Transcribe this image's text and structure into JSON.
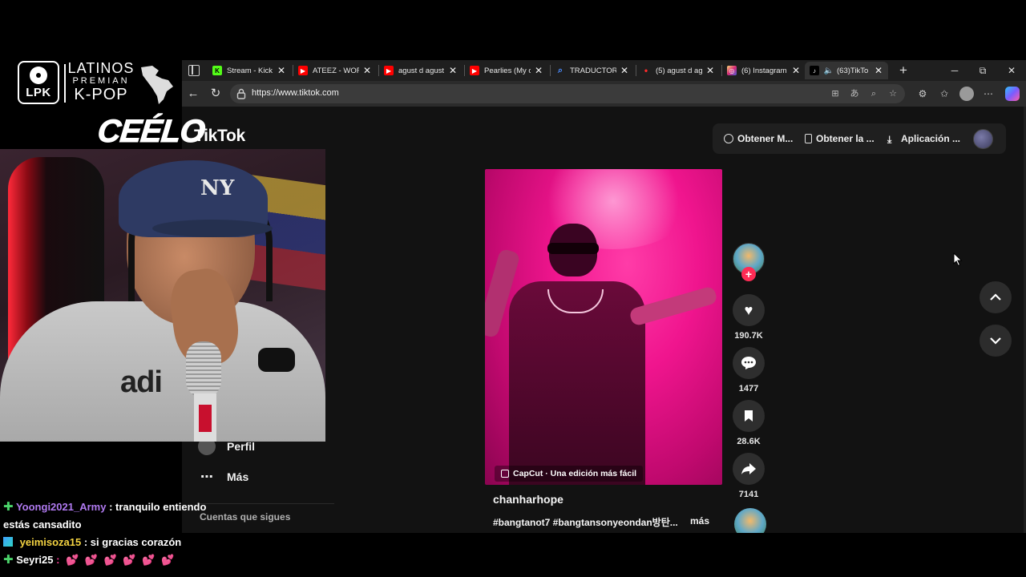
{
  "overlay": {
    "logo": {
      "badge": "LPK",
      "line1": "LATINOS",
      "line2": "PREMIAN",
      "line3": "K-POP"
    },
    "streamer_name": "CEÉLO"
  },
  "browser": {
    "tabs": [
      {
        "label": "Stream - Kick",
        "favicon_color": "#53fc18",
        "favicon_glyph": "K"
      },
      {
        "label": "ATEEZ - WORK",
        "favicon_color": "#ff0000",
        "favicon_glyph": "▶"
      },
      {
        "label": "agust d agust",
        "favicon_color": "#ff0000",
        "favicon_glyph": "▶"
      },
      {
        "label": "Pearlies (My o",
        "favicon_color": "#ff0000",
        "favicon_glyph": "▶"
      },
      {
        "label": "TRADUCTOR -",
        "favicon_color": "#4a8cff",
        "favicon_glyph": "⌕"
      },
      {
        "label": "(5) agust d ag",
        "favicon_color": "#ff0000",
        "favicon_glyph": "•"
      },
      {
        "label": "(6) Instagram",
        "favicon_color": "#e1306c",
        "favicon_glyph": "◎"
      },
      {
        "label": "(63)TikTo",
        "favicon_color": "#ffffff",
        "favicon_glyph": "♪",
        "active": true
      }
    ],
    "url": "https://www.tiktok.com",
    "window_controls": {
      "minimize": "─",
      "restore": "⧉",
      "close": "✕"
    }
  },
  "tiktok": {
    "logo_text": "TikTok",
    "topbar": {
      "get_coins": "Obtener M...",
      "get_app": "Obtener la ...",
      "download_app": "Aplicación ..."
    },
    "sidebar": {
      "profile": "Perfil",
      "more": "Más",
      "following_accounts": "Cuentas que sigues"
    },
    "video": {
      "capcut_label": "CapCut · Una edición más fácil",
      "author": "chanharhope",
      "hashtags": "#bangtanot7 #bangtansonyeondan방탄...",
      "more_label": "más"
    },
    "actions": {
      "likes": "190.7K",
      "comments": "1477",
      "saves": "28.6K",
      "shares": "7141"
    },
    "colors": {
      "follow_plus": "#fe2c55",
      "video_pink": "#f0158e"
    }
  },
  "chat": [
    {
      "badge": "plus",
      "user": "Yoongi2021_Army",
      "message": ": tranquilo entiendo estás cansadito",
      "user_color": "#b07af0"
    },
    {
      "badge": "cube",
      "user": "yeimisoza15",
      "message": ": si gracias corazón",
      "user_color": "#f5d442"
    },
    {
      "badge": "plus",
      "user": "Seyri25",
      "message": ": 💕 💕 💕 💕 💕 💕",
      "user_color": "#ffffff"
    }
  ]
}
